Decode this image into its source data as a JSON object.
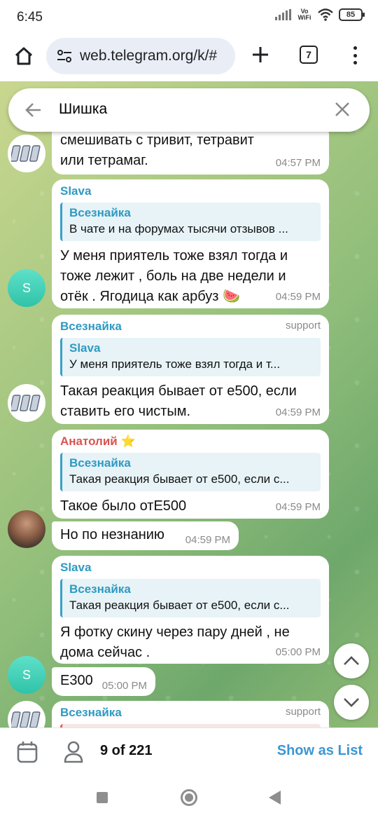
{
  "status": {
    "time": "6:45",
    "network": "Vo WiFi",
    "battery": "85"
  },
  "browser": {
    "url": "web.telegram.org/k/#",
    "tabs_count": "7"
  },
  "search": {
    "query": "Шишка"
  },
  "messages": [
    {
      "sender": "",
      "text": "смешивать с тривит, тетравит или тетрамаг.",
      "time": "04:57 PM"
    },
    {
      "sender": "Slava",
      "sender_color": "#2e9ac2",
      "reply_name": "Всезнайка",
      "reply_text": "В чате и на форумах тысячи отзывов ...",
      "text": "У меня приятель тоже взял тогда и тоже лежит , боль на две недели и отёк . Ягодица как арбуз 🍉",
      "time": "04:59 PM"
    },
    {
      "sender": "Всезнайка",
      "sender_color": "#2e9ac2",
      "role": "support",
      "reply_name": "Slava",
      "reply_text": "У меня приятель тоже взял тогда и т...",
      "text": "Такая реакция бывает от е500, если ставить его чистым.",
      "time": "04:59 PM"
    },
    {
      "sender": "Анатолий ⭐",
      "sender_color": "#d9534f",
      "reply_name": "Всезнайка",
      "reply_text": "Такая реакция бывает от е500, если с...",
      "text": "Такое было отЕ500",
      "time": "04:59 PM"
    },
    {
      "sender": "",
      "text": "Но по незнанию",
      "time": "04:59 PM"
    },
    {
      "sender": "Slava",
      "sender_color": "#2e9ac2",
      "reply_name": "Всезнайка",
      "reply_text": "Такая реакция бывает от е500, если с...",
      "text": "Я фотку скину через пару дней , не дома сейчас .",
      "time": "05:00 PM"
    },
    {
      "sender": "",
      "text": "Е300",
      "time": "05:00 PM"
    },
    {
      "sender": "Всезнайка",
      "sender_color": "#2e9ac2",
      "role": "support",
      "text": ""
    }
  ],
  "avatars": {
    "slava_letter": "S"
  },
  "footer": {
    "count": "9 of 221",
    "show_list": "Show as List"
  },
  "colors": {
    "accent": "#3b96d4",
    "link_name": "#2e9ac2",
    "anatoliy": "#d9534f"
  }
}
